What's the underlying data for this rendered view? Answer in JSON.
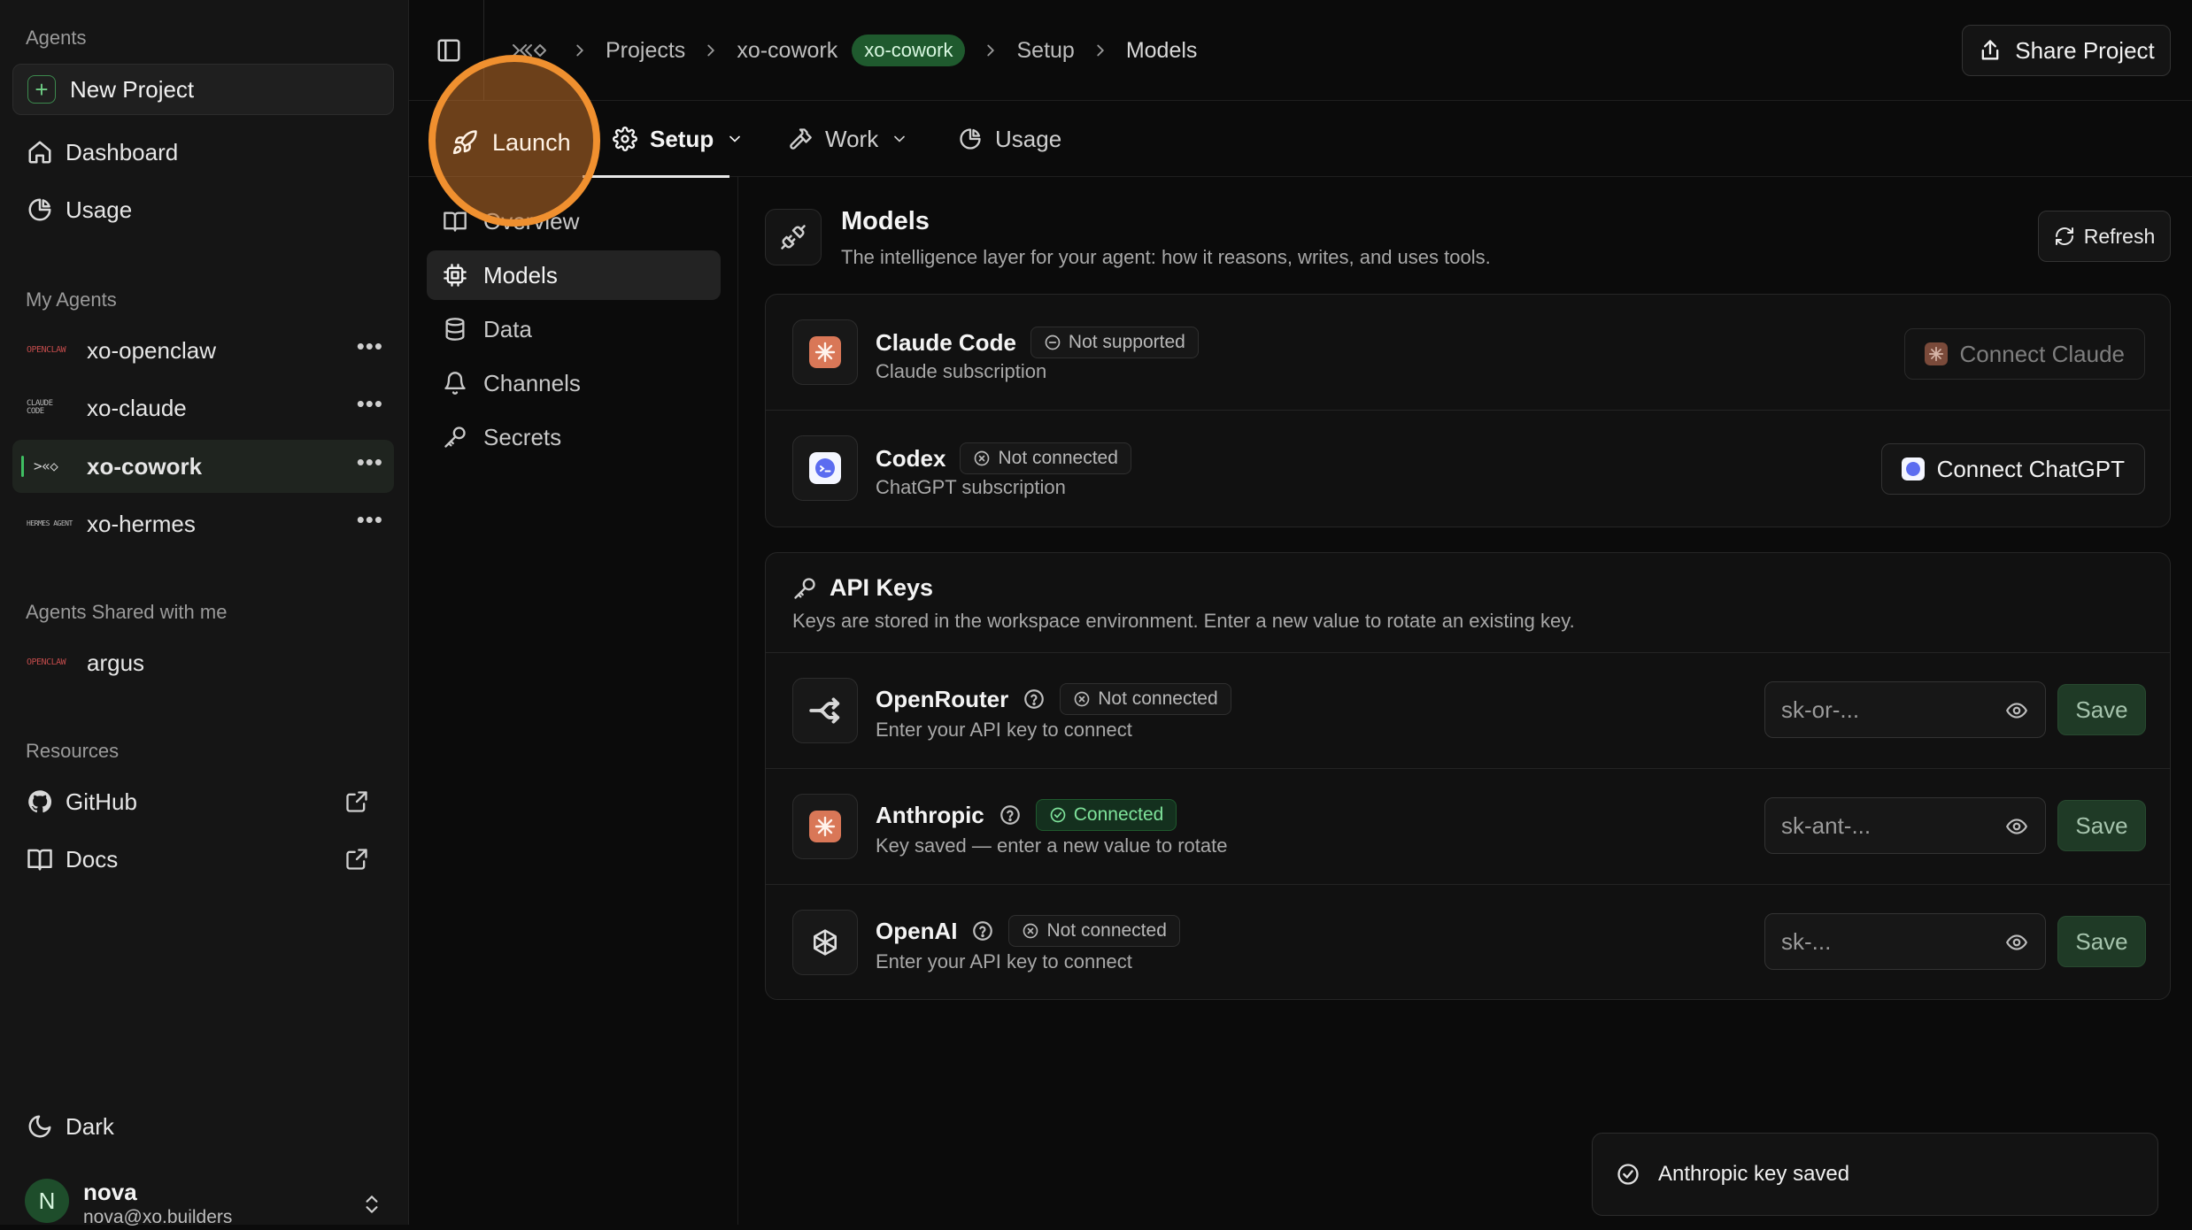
{
  "sidebar": {
    "agents_label": "Agents",
    "new_project_label": "New Project",
    "nav": [
      {
        "label": "Dashboard",
        "icon": "home-icon"
      },
      {
        "label": "Usage",
        "icon": "pie-chart-icon"
      }
    ],
    "my_agents_label": "My Agents",
    "my_agents": [
      {
        "name": "xo-openclaw",
        "logo_text": "OPENCLAW",
        "active": false
      },
      {
        "name": "xo-claude",
        "logo_text": "CLAUDE CODE",
        "active": false
      },
      {
        "name": "xo-cowork",
        "logo_text": ">«◇",
        "active": true
      },
      {
        "name": "xo-hermes",
        "logo_text": "HERMES AGENT",
        "active": false
      }
    ],
    "shared_label": "Agents Shared with me",
    "shared_agents": [
      {
        "name": "argus",
        "logo_text": "OPENCLAW"
      }
    ],
    "resources_label": "Resources",
    "resources": [
      {
        "label": "GitHub",
        "icon": "github-icon"
      },
      {
        "label": "Docs",
        "icon": "book-icon"
      }
    ],
    "theme_label": "Dark",
    "user": {
      "initial": "N",
      "name": "nova",
      "email": "nova@xo.builders"
    }
  },
  "breadcrumb": {
    "root_icon": "xo-logo-icon",
    "items": [
      "Projects",
      "xo-cowork",
      "Setup",
      "Models"
    ],
    "tag": "xo-cowork"
  },
  "share_label": "Share Project",
  "tabs": [
    {
      "label": "Launch",
      "icon": "rocket-icon"
    },
    {
      "label": "Setup",
      "icon": "gear-icon",
      "active": true
    },
    {
      "label": "Work",
      "icon": "hammer-icon"
    },
    {
      "label": "Usage",
      "icon": "pie-chart-icon"
    }
  ],
  "subnav": [
    {
      "label": "Overview",
      "icon": "book-icon"
    },
    {
      "label": "Models",
      "icon": "cpu-icon",
      "active": true
    },
    {
      "label": "Data",
      "icon": "database-icon"
    },
    {
      "label": "Channels",
      "icon": "bell-icon"
    },
    {
      "label": "Secrets",
      "icon": "key-icon"
    }
  ],
  "models": {
    "title": "Models",
    "subtitle": "The intelligence layer for your agent: how it reasons, writes, and uses tools.",
    "refresh_label": "Refresh",
    "subscriptions": [
      {
        "name": "Claude Code",
        "status": "Not supported",
        "sub": "Claude subscription",
        "button": "Connect Claude",
        "color": "#d97757"
      },
      {
        "name": "Codex",
        "status": "Not connected",
        "sub": "ChatGPT subscription",
        "button": "Connect ChatGPT",
        "color": "#5b6cf0"
      }
    ]
  },
  "api_keys": {
    "title": "API Keys",
    "subtitle": "Keys are stored in the workspace environment. Enter a new value to rotate an existing key.",
    "save_label": "Save",
    "providers": [
      {
        "name": "OpenRouter",
        "status": "Not connected",
        "connected": false,
        "sub": "Enter your API key to connect",
        "placeholder": "sk-or-..."
      },
      {
        "name": "Anthropic",
        "status": "Connected",
        "connected": true,
        "sub": "Key saved — enter a new value to rotate",
        "placeholder": "sk-ant-..."
      },
      {
        "name": "OpenAI",
        "status": "Not connected",
        "connected": false,
        "sub": "Enter your API key to connect",
        "placeholder": "sk-..."
      }
    ]
  },
  "toast": {
    "message": "Anthropic key saved"
  },
  "colors": {
    "accent_green": "#1f5a2e",
    "launch_orange": "#f0902f",
    "background": "#0b0b0b"
  }
}
